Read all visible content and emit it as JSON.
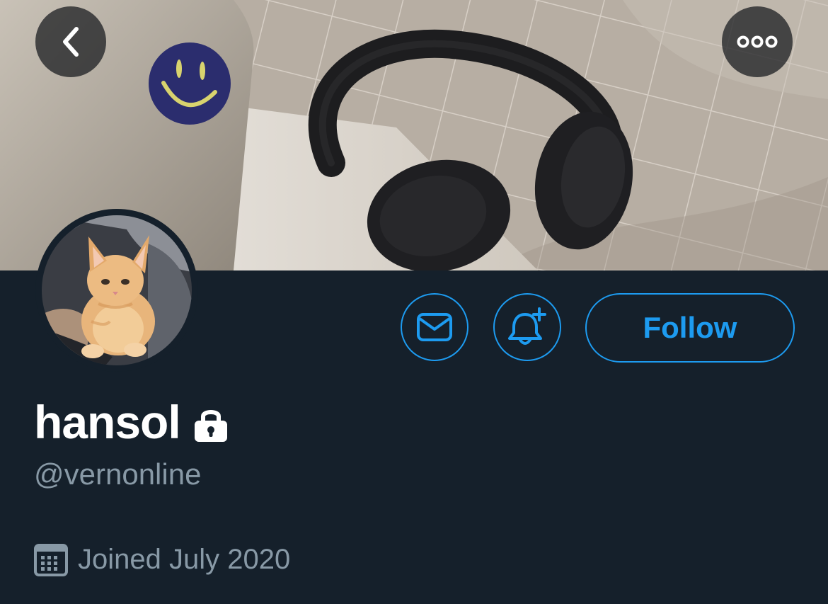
{
  "banner": {
    "description_icon": "banner-photo"
  },
  "nav": {
    "back_icon": "chevron-left-icon",
    "more_icon": "more-horizontal-icon"
  },
  "actions": {
    "message_icon": "mail-icon",
    "notify_icon": "bell-plus-icon",
    "follow_label": "Follow"
  },
  "profile": {
    "display_name": "hansol",
    "protected_icon": "lock-icon",
    "handle": "@vernonline",
    "joined_icon": "calendar-icon",
    "joined": "Joined July 2020"
  },
  "colors": {
    "background": "#15202b",
    "accent": "#1d9bf0",
    "secondary_text": "#8899a6",
    "primary_text": "#ffffff"
  }
}
